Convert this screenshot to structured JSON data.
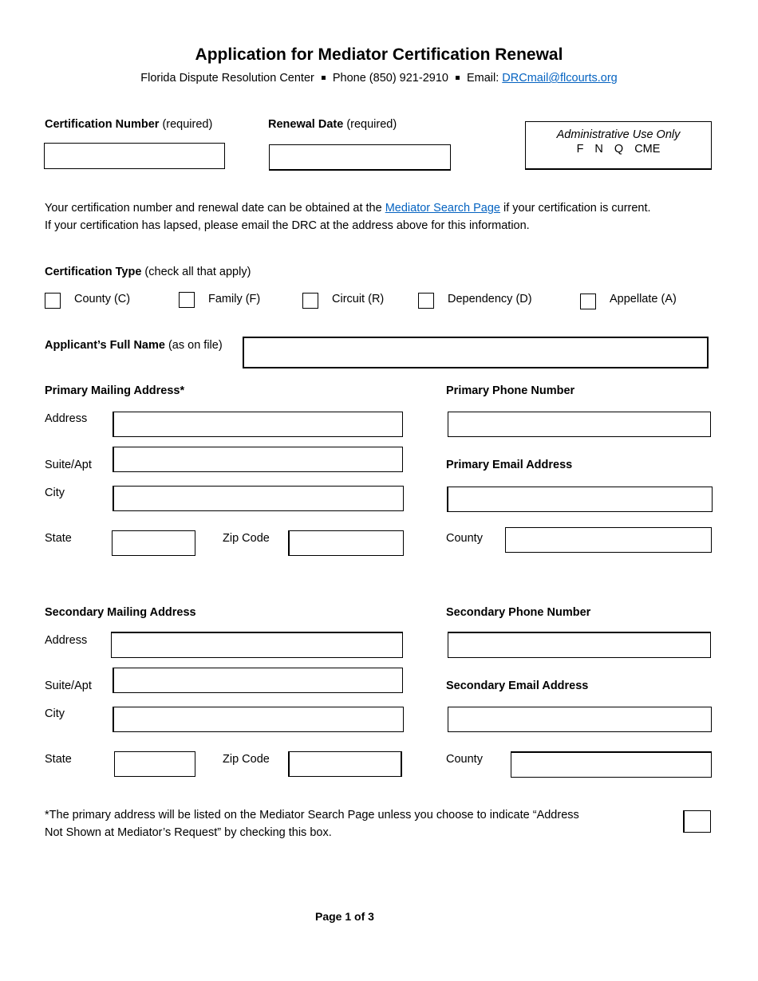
{
  "header": {
    "title": "Application for Mediator Certification Renewal",
    "org": "Florida Dispute Resolution Center",
    "phone": "Phone (850) 921-2910",
    "email_label": "Email:",
    "email_link": "DRCmail@flcourts.org"
  },
  "cert_number": {
    "label": "Certification Number",
    "note": "(required)",
    "value": ""
  },
  "renewal_date": {
    "label": "Renewal Date",
    "note": "(required)",
    "value": ""
  },
  "admin_box": {
    "title": "Administrative Use Only",
    "codes": [
      "F",
      "N",
      "Q",
      "CME"
    ]
  },
  "info": {
    "line1_before": "Your certification number and renewal date can be obtained at the ",
    "link": "Mediator Search Page",
    "line1_after": " if your certification is current.",
    "line2": "If your certification has lapsed, please email the DRC at the address above for this information."
  },
  "cert_type": {
    "label": "Certification Type",
    "note": "(check all that apply)",
    "options": [
      {
        "label": "County (C)",
        "checked": false
      },
      {
        "label": "Family (F)",
        "checked": false
      },
      {
        "label": "Circuit (R)",
        "checked": false
      },
      {
        "label": "Dependency (D)",
        "checked": false
      },
      {
        "label": "Appellate (A)",
        "checked": false
      }
    ]
  },
  "full_name": {
    "label": "Applicant’s Full Name",
    "note": "(as on file)",
    "value": ""
  },
  "primary": {
    "heading": "Primary Mailing Address*",
    "address_label": "Address",
    "suite_label": "Suite/Apt",
    "city_label": "City",
    "state_label": "State",
    "zip_label": "Zip Code",
    "phone_heading": "Primary Phone Number",
    "email_heading": "Primary Email Address",
    "county_label": "County"
  },
  "secondary": {
    "heading": "Secondary Mailing Address",
    "address_label": "Address",
    "suite_label": "Suite/Apt",
    "city_label": "City",
    "state_label": "State",
    "zip_label": "Zip Code",
    "phone_heading": "Secondary Phone Number",
    "email_heading": "Secondary Email Address",
    "county_label": "County"
  },
  "footnote": {
    "line1": "*The primary address will be listed on the Mediator Search Page unless you choose to indicate “Address",
    "line2": "Not Shown at Mediator’s Request” by checking this box.",
    "checked": false
  },
  "footer": {
    "page": "Page 1 of 3"
  }
}
